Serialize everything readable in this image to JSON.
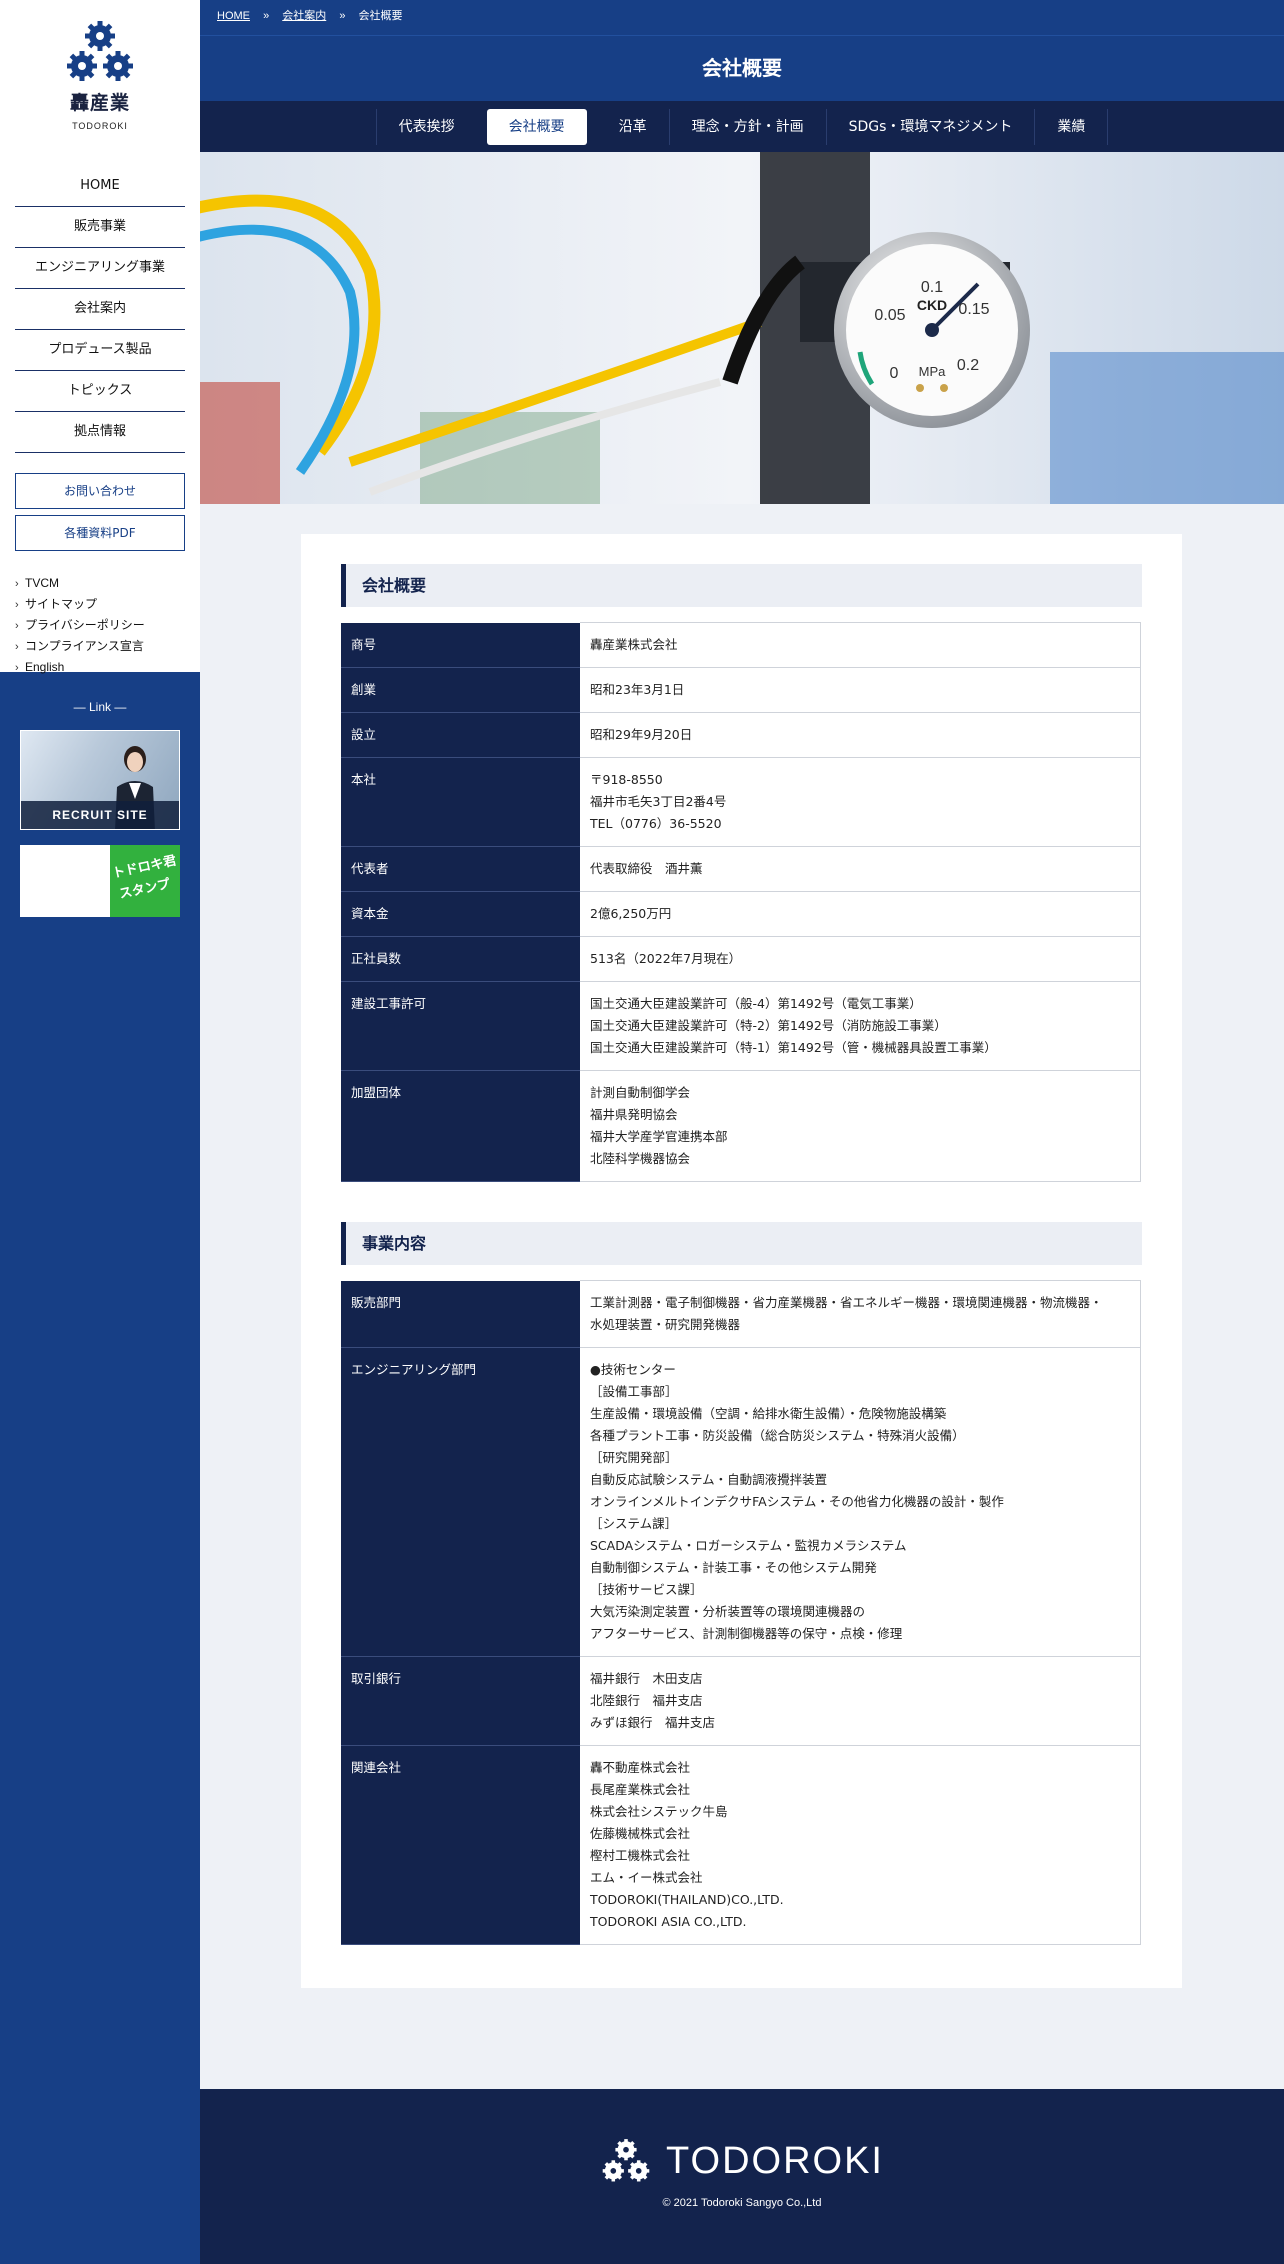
{
  "sidebar": {
    "logo_jp": "轟産業",
    "logo_en": "TODOROKI",
    "nav": [
      "HOME",
      "販売事業",
      "エンジニアリング事業",
      "会社案内",
      "プロデュース製品",
      "トピックス",
      "拠点情報"
    ],
    "contact_label": "お問い合わせ",
    "pdf_label": "各種資料PDF",
    "sub_links": [
      "TVCM",
      "サイトマップ",
      "プライバシーポリシー",
      "コンプライアンス宣言",
      "English"
    ],
    "link_heading": "— Link —",
    "recruit_label": "RECRUIT SITE",
    "stamp_line1": "トドロキ君",
    "stamp_line2": "スタンプ"
  },
  "breadcrumb": {
    "home": "HOME",
    "sep1": "»",
    "about": "会社案内",
    "sep2": "»",
    "current": "会社概要"
  },
  "page_title": "会社概要",
  "tabs": [
    "代表挨拶",
    "会社概要",
    "沿革",
    "理念・方針・計画",
    "SDGs・環境マネジメント",
    "業績"
  ],
  "active_tab": 1,
  "hero": {
    "gauge_top": "0.1",
    "gauge_left": "0.05",
    "gauge_right": "0.15",
    "gauge_brand": "CKD",
    "gauge_zero": "0",
    "gauge_unit": "MPa",
    "gauge_max": "0.2"
  },
  "overview": {
    "heading": "会社概要",
    "rows": [
      {
        "label": "商号",
        "lines": [
          "轟産業株式会社"
        ]
      },
      {
        "label": "創業",
        "lines": [
          "昭和23年3月1日"
        ]
      },
      {
        "label": "設立",
        "lines": [
          "昭和29年9月20日"
        ]
      },
      {
        "label": "本社",
        "lines": [
          "〒918-8550",
          "福井市毛矢3丁目2番4号",
          "TEL（0776）36-5520"
        ]
      },
      {
        "label": "代表者",
        "lines": [
          "代表取締役　酒井薫"
        ]
      },
      {
        "label": "資本金",
        "lines": [
          "2億6,250万円"
        ]
      },
      {
        "label": "正社員数",
        "lines": [
          "513名（2022年7月現在）"
        ]
      },
      {
        "label": "建設工事許可",
        "lines": [
          "国土交通大臣建設業許可（般-4）第1492号（電気工事業）",
          "国土交通大臣建設業許可（特-2）第1492号（消防施設工事業）",
          "国土交通大臣建設業許可（特-1）第1492号（管・機械器具設置工事業）"
        ]
      },
      {
        "label": "加盟団体",
        "lines": [
          "計測自動制御学会",
          "福井県発明協会",
          "福井大学産学官連携本部",
          "北陸科学機器協会"
        ]
      }
    ]
  },
  "business": {
    "heading": "事業内容",
    "rows": [
      {
        "label": "販売部門",
        "lines": [
          "工業計測器・電子制御機器・省力産業機器・省エネルギー機器・環境関連機器・物流機器・",
          "水処理装置・研究開発機器"
        ]
      },
      {
        "label": "エンジニアリング部門",
        "lines": [
          "●技術センター",
          "［設備工事部］",
          "生産設備・環境設備（空調・給排水衛生設備）・危険物施設構築",
          "各種プラント工事・防災設備（総合防災システム・特殊消火設備）",
          "［研究開発部］",
          "自動反応試験システム・自動調液攪拌装置",
          "オンラインメルトインデクサFAシステム・その他省力化機器の設計・製作",
          "［システム課］",
          "SCADAシステム・ロガーシステム・監視カメラシステム",
          "自動制御システム・計装工事・その他システム開発",
          "［技術サービス課］",
          "大気汚染測定装置・分析装置等の環境関連機器の",
          "アフターサービス、計測制御機器等の保守・点検・修理"
        ]
      },
      {
        "label": "取引銀行",
        "lines": [
          "福井銀行　木田支店",
          "北陸銀行　福井支店",
          "みずほ銀行　福井支店"
        ]
      },
      {
        "label": "関連会社",
        "lines": [
          "轟不動産株式会社",
          "長尾産業株式会社",
          "株式会社システック牛島",
          "佐藤機械株式会社",
          "樫村工機株式会社",
          "エム・イー株式会社",
          "TODOROKI(THAILAND)CO.,LTD.",
          "TODOROKI ASIA CO.,LTD."
        ]
      }
    ]
  },
  "footer": {
    "logo_text": "TODOROKI",
    "copyright": "© 2021 Todoroki Sangyo Co.,Ltd"
  },
  "colors": {
    "navy": "#13234d",
    "blue": "#173f86",
    "stamp_green": "#32b13e"
  }
}
